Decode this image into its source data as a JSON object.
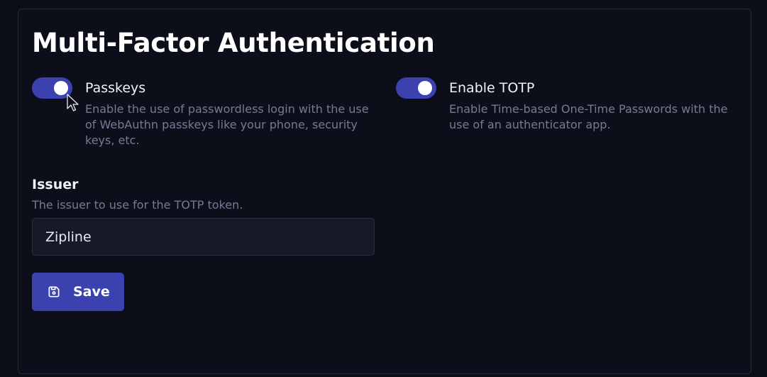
{
  "section": {
    "title": "Multi-Factor Authentication"
  },
  "passkeys": {
    "label": "Passkeys",
    "description": "Enable the use of passwordless login with the use of WebAuthn passkeys like your phone, security keys, etc.",
    "enabled": true
  },
  "totp": {
    "label": "Enable TOTP",
    "description": "Enable Time-based One-Time Passwords with the use of an authenticator app.",
    "enabled": true
  },
  "issuer": {
    "label": "Issuer",
    "description": "The issuer to use for the TOTP token.",
    "value": "Zipline"
  },
  "save_button": {
    "label": "Save",
    "icon": "device-floppy-icon"
  },
  "colors": {
    "accent": "#3b42b0",
    "background": "#0c0e1a",
    "muted_text": "#757b92"
  }
}
